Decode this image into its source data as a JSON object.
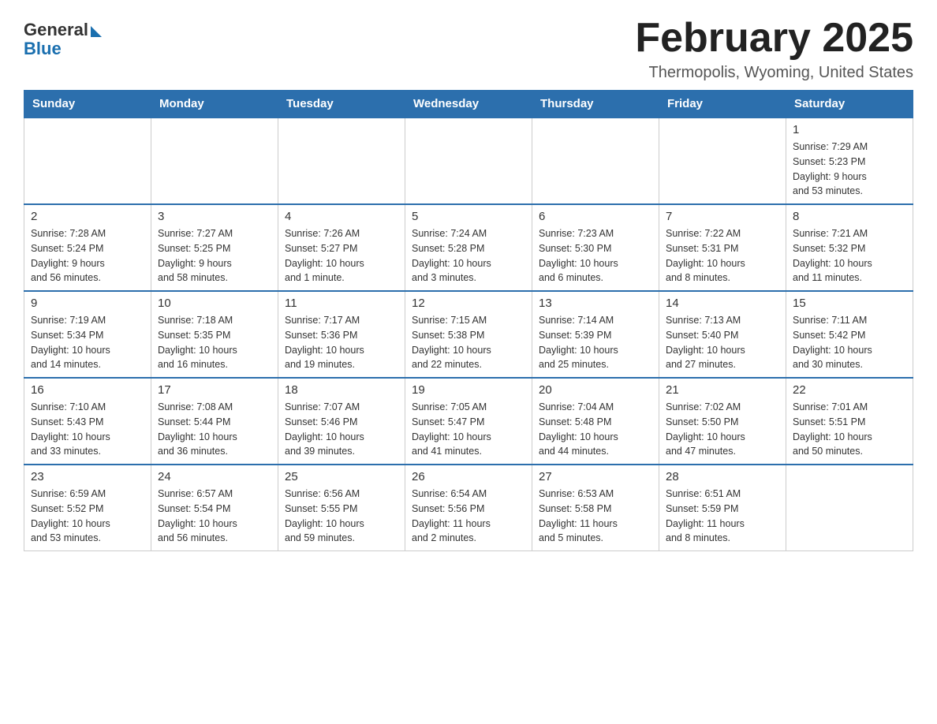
{
  "logo": {
    "general": "General",
    "blue": "Blue"
  },
  "title": "February 2025",
  "location": "Thermopolis, Wyoming, United States",
  "days_of_week": [
    "Sunday",
    "Monday",
    "Tuesday",
    "Wednesday",
    "Thursday",
    "Friday",
    "Saturday"
  ],
  "weeks": [
    [
      {
        "day": "",
        "info": ""
      },
      {
        "day": "",
        "info": ""
      },
      {
        "day": "",
        "info": ""
      },
      {
        "day": "",
        "info": ""
      },
      {
        "day": "",
        "info": ""
      },
      {
        "day": "",
        "info": ""
      },
      {
        "day": "1",
        "info": "Sunrise: 7:29 AM\nSunset: 5:23 PM\nDaylight: 9 hours\nand 53 minutes."
      }
    ],
    [
      {
        "day": "2",
        "info": "Sunrise: 7:28 AM\nSunset: 5:24 PM\nDaylight: 9 hours\nand 56 minutes."
      },
      {
        "day": "3",
        "info": "Sunrise: 7:27 AM\nSunset: 5:25 PM\nDaylight: 9 hours\nand 58 minutes."
      },
      {
        "day": "4",
        "info": "Sunrise: 7:26 AM\nSunset: 5:27 PM\nDaylight: 10 hours\nand 1 minute."
      },
      {
        "day": "5",
        "info": "Sunrise: 7:24 AM\nSunset: 5:28 PM\nDaylight: 10 hours\nand 3 minutes."
      },
      {
        "day": "6",
        "info": "Sunrise: 7:23 AM\nSunset: 5:30 PM\nDaylight: 10 hours\nand 6 minutes."
      },
      {
        "day": "7",
        "info": "Sunrise: 7:22 AM\nSunset: 5:31 PM\nDaylight: 10 hours\nand 8 minutes."
      },
      {
        "day": "8",
        "info": "Sunrise: 7:21 AM\nSunset: 5:32 PM\nDaylight: 10 hours\nand 11 minutes."
      }
    ],
    [
      {
        "day": "9",
        "info": "Sunrise: 7:19 AM\nSunset: 5:34 PM\nDaylight: 10 hours\nand 14 minutes."
      },
      {
        "day": "10",
        "info": "Sunrise: 7:18 AM\nSunset: 5:35 PM\nDaylight: 10 hours\nand 16 minutes."
      },
      {
        "day": "11",
        "info": "Sunrise: 7:17 AM\nSunset: 5:36 PM\nDaylight: 10 hours\nand 19 minutes."
      },
      {
        "day": "12",
        "info": "Sunrise: 7:15 AM\nSunset: 5:38 PM\nDaylight: 10 hours\nand 22 minutes."
      },
      {
        "day": "13",
        "info": "Sunrise: 7:14 AM\nSunset: 5:39 PM\nDaylight: 10 hours\nand 25 minutes."
      },
      {
        "day": "14",
        "info": "Sunrise: 7:13 AM\nSunset: 5:40 PM\nDaylight: 10 hours\nand 27 minutes."
      },
      {
        "day": "15",
        "info": "Sunrise: 7:11 AM\nSunset: 5:42 PM\nDaylight: 10 hours\nand 30 minutes."
      }
    ],
    [
      {
        "day": "16",
        "info": "Sunrise: 7:10 AM\nSunset: 5:43 PM\nDaylight: 10 hours\nand 33 minutes."
      },
      {
        "day": "17",
        "info": "Sunrise: 7:08 AM\nSunset: 5:44 PM\nDaylight: 10 hours\nand 36 minutes."
      },
      {
        "day": "18",
        "info": "Sunrise: 7:07 AM\nSunset: 5:46 PM\nDaylight: 10 hours\nand 39 minutes."
      },
      {
        "day": "19",
        "info": "Sunrise: 7:05 AM\nSunset: 5:47 PM\nDaylight: 10 hours\nand 41 minutes."
      },
      {
        "day": "20",
        "info": "Sunrise: 7:04 AM\nSunset: 5:48 PM\nDaylight: 10 hours\nand 44 minutes."
      },
      {
        "day": "21",
        "info": "Sunrise: 7:02 AM\nSunset: 5:50 PM\nDaylight: 10 hours\nand 47 minutes."
      },
      {
        "day": "22",
        "info": "Sunrise: 7:01 AM\nSunset: 5:51 PM\nDaylight: 10 hours\nand 50 minutes."
      }
    ],
    [
      {
        "day": "23",
        "info": "Sunrise: 6:59 AM\nSunset: 5:52 PM\nDaylight: 10 hours\nand 53 minutes."
      },
      {
        "day": "24",
        "info": "Sunrise: 6:57 AM\nSunset: 5:54 PM\nDaylight: 10 hours\nand 56 minutes."
      },
      {
        "day": "25",
        "info": "Sunrise: 6:56 AM\nSunset: 5:55 PM\nDaylight: 10 hours\nand 59 minutes."
      },
      {
        "day": "26",
        "info": "Sunrise: 6:54 AM\nSunset: 5:56 PM\nDaylight: 11 hours\nand 2 minutes."
      },
      {
        "day": "27",
        "info": "Sunrise: 6:53 AM\nSunset: 5:58 PM\nDaylight: 11 hours\nand 5 minutes."
      },
      {
        "day": "28",
        "info": "Sunrise: 6:51 AM\nSunset: 5:59 PM\nDaylight: 11 hours\nand 8 minutes."
      },
      {
        "day": "",
        "info": ""
      }
    ]
  ]
}
